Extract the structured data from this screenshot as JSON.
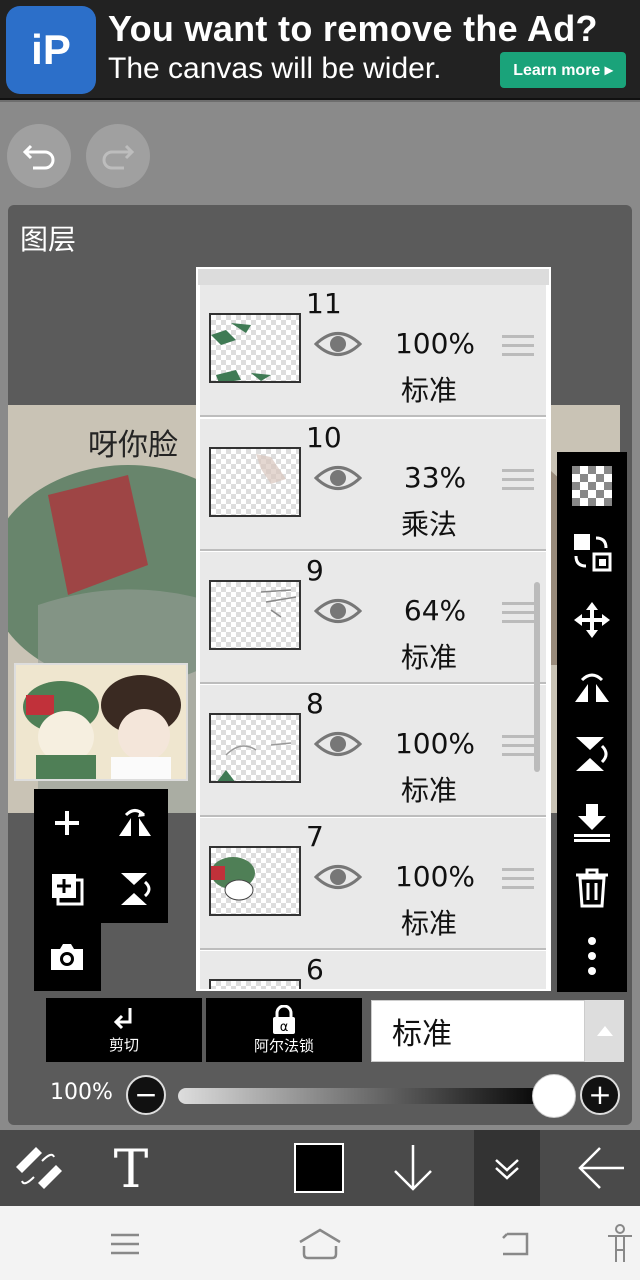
{
  "ad": {
    "logo_text": "iP",
    "title": "You want to remove the Ad?",
    "subtitle": "The canvas will be wider.",
    "button_label": "Learn more ▸"
  },
  "panel": {
    "title": "图层"
  },
  "layers": [
    {
      "number": "11",
      "opacity": "100%",
      "mode": "标准"
    },
    {
      "number": "10",
      "opacity": "33%",
      "mode": "乘法"
    },
    {
      "number": "9",
      "opacity": "64%",
      "mode": "标准"
    },
    {
      "number": "8",
      "opacity": "100%",
      "mode": "标准"
    },
    {
      "number": "7",
      "opacity": "100%",
      "mode": "标准"
    },
    {
      "number": "6",
      "opacity": "",
      "mode": ""
    }
  ],
  "bottom": {
    "clip_label": "剪切",
    "alpha_lock_label": "阿尔法锁",
    "blend_mode": "标准"
  },
  "opacity": {
    "label": "100%",
    "value": 1.0
  },
  "colors": {
    "accent": "#1aa37a",
    "current_color": "#000000"
  },
  "icons": {
    "undo": "undo-icon",
    "redo": "redo-icon",
    "add_layer": "plus-icon",
    "flip_h": "flip-horizontal-icon",
    "duplicate": "duplicate-layer-icon",
    "flip_v": "flip-vertical-icon",
    "camera": "camera-icon",
    "transparency": "checkerboard-icon",
    "swap": "swap-layer-icon",
    "move": "move-icon",
    "merge_down": "merge-down-icon",
    "delete": "trash-icon",
    "more": "more-vertical-icon"
  }
}
